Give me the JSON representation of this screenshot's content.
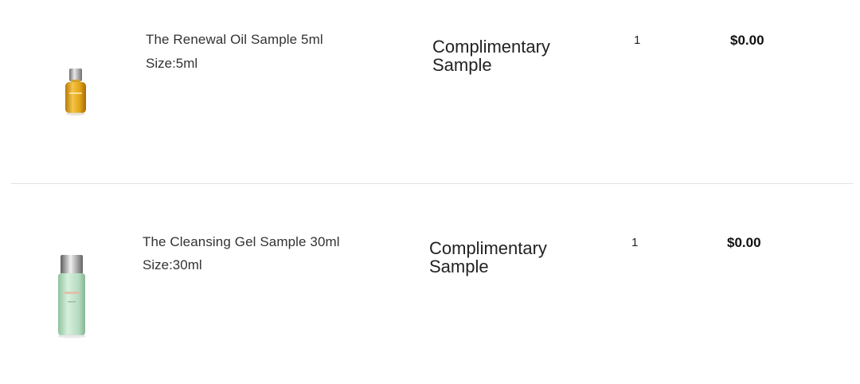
{
  "cart": {
    "items": [
      {
        "name": "The Renewal Oil Sample 5ml",
        "size": "Size:5ml",
        "status_line1": "Complimentary",
        "status_line2": "Sample",
        "quantity": "1",
        "price": "$0.00",
        "image_icon": "oil-bottle-icon",
        "image_color": "#e8a81c"
      },
      {
        "name": "The Cleansing Gel Sample 30ml",
        "size": "Size:30ml",
        "status_line1": "Complimentary",
        "status_line2": "Sample",
        "quantity": "1",
        "price": "$0.00",
        "image_icon": "gel-bottle-icon",
        "image_color": "#bfe3c8"
      }
    ]
  }
}
